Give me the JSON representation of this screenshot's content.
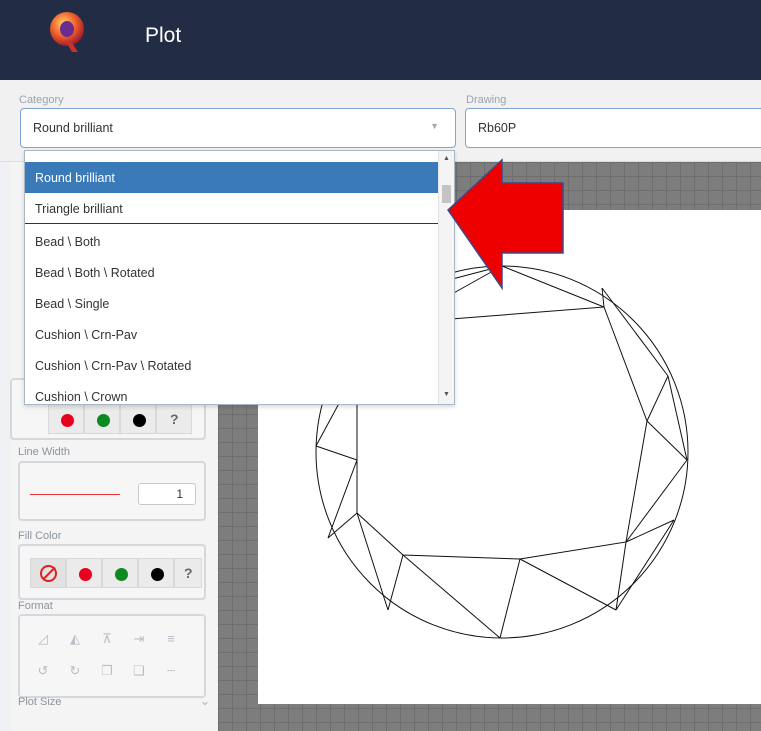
{
  "header": {
    "title": "Plot"
  },
  "toolbar": {
    "category": {
      "label": "Category",
      "value": "Round brilliant"
    },
    "drawing": {
      "label": "Drawing",
      "value": "Rb60P"
    }
  },
  "dropdown": {
    "items": [
      {
        "label": "Round brilliant",
        "selected": true
      },
      {
        "label": "Triangle brilliant",
        "selected": false
      },
      {
        "label": "Bead \\ Both",
        "selected": false
      },
      {
        "label": "Bead \\ Both \\ Rotated",
        "selected": false
      },
      {
        "label": "Bead \\ Single",
        "selected": false
      },
      {
        "label": "Cushion \\ Crn-Pav",
        "selected": false
      },
      {
        "label": "Cushion \\ Crn-Pav \\ Rotated",
        "selected": false
      },
      {
        "label": "Cushion \\ Crown",
        "selected": false
      }
    ]
  },
  "left_panel": {
    "line_color_buttons": [
      "red",
      "green",
      "black",
      "?"
    ],
    "line_width": {
      "label": "Line Width",
      "value": "1"
    },
    "fill_color": {
      "label": "Fill Color",
      "buttons": [
        "none",
        "red",
        "green",
        "black",
        "?"
      ]
    },
    "format": {
      "label": "Format"
    },
    "plot_size": {
      "label": "Plot Size"
    }
  },
  "colors": {
    "header_bg": "#222d45",
    "selected_item": "#3a7ab8",
    "red": "#e8001c",
    "green": "#0a8a1f",
    "black": "#000000",
    "arrow": "#ee0000"
  }
}
